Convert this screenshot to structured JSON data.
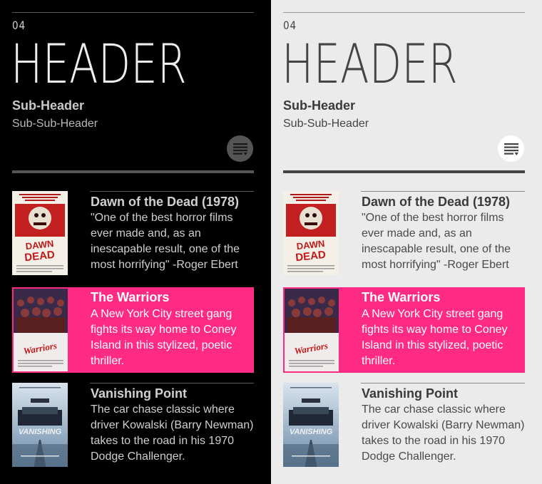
{
  "screen": {
    "number": "04",
    "header": "HEADER",
    "subheader": "Sub-Header",
    "subsubheader": "Sub-Sub-Header"
  },
  "menu_icon": "filter-list-icon",
  "accent_color": "#ff2a83",
  "items": [
    {
      "title": "Dawn of the Dead (1978)",
      "description": "\"One of the best horror films ever made and, as an inescapable result, one of the most horrifying\" -Roger Ebert",
      "poster_tagline": "When there's no more room in HELL the dead will walk the EARTH",
      "poster_title": "DAWN of the DEAD",
      "selected": false
    },
    {
      "title": "The Warriors",
      "description": "A New York City street gang fights its way home to Coney Island in this stylized, poetic thriller.",
      "poster_title": "The Warriors",
      "selected": true
    },
    {
      "title": "Vanishing Point",
      "description": "The car chase classic where driver Kowalski (Barry Newman) takes to the road in his 1970 Dodge Challenger.",
      "poster_title": "VANISHING POINT",
      "poster_tagline": "THE ULTIMATE CAR CHASE MOVIE!",
      "selected": false
    }
  ]
}
